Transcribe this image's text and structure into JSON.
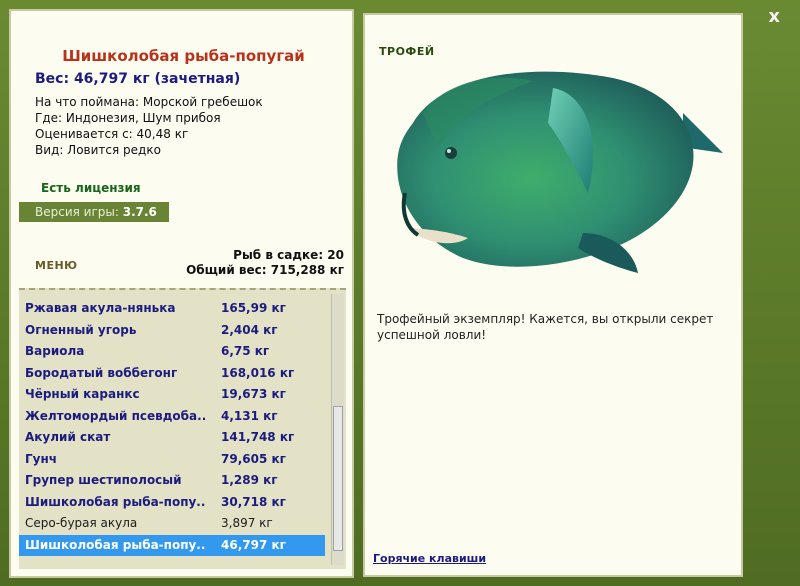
{
  "window": {
    "close_label": "x"
  },
  "fish": {
    "title": "Шишколобая рыба-попугай",
    "weight_line": "Вес: 46,797 кг (зачетная)",
    "caught_with": "На что поймана: Морской гребешок",
    "location": "Где: Индонезия, Шум прибоя",
    "min_weight": "Оценивается с: 40,48 кг",
    "rarity": "Вид: Ловится редко"
  },
  "license_text": "Есть лицензия",
  "version": {
    "label": "Версия игры:",
    "value": "3.7.6"
  },
  "menu_label": "МЕНЮ",
  "cage": {
    "count_line": "Рыб в садке: 20",
    "total_line": "Общий вес: 715,288 кг"
  },
  "catch_list": [
    {
      "name": "Ржавая акула-нянька",
      "weight": "165,99 кг",
      "style": "bold"
    },
    {
      "name": "Огненный угорь",
      "weight": "2,404 кг",
      "style": "bold"
    },
    {
      "name": "Вариола",
      "weight": "6,75 кг",
      "style": "bold"
    },
    {
      "name": "Бородатый воббегонг",
      "weight": "168,016 кг",
      "style": "bold"
    },
    {
      "name": "Чёрный каранкс",
      "weight": "19,673 кг",
      "style": "bold"
    },
    {
      "name": "Желтомордый псевдоба...",
      "weight": "4,131 кг",
      "style": "bold"
    },
    {
      "name": "Акулий скат",
      "weight": "141,748 кг",
      "style": "bold"
    },
    {
      "name": "Гунч",
      "weight": "79,605 кг",
      "style": "bold"
    },
    {
      "name": "Групер шестиполосый",
      "weight": "1,289 кг",
      "style": "bold"
    },
    {
      "name": "Шишколобая рыба-попу...",
      "weight": "30,718 кг",
      "style": "bold"
    },
    {
      "name": "Серо-бурая акула",
      "weight": "3,897 кг",
      "style": "plain"
    },
    {
      "name": "Шишколобая рыба-попу...",
      "weight": "46,797 кг",
      "style": "selected"
    }
  ],
  "trophy": {
    "label": "ТРОФЕЙ",
    "description": "Трофейный экземпляр! Кажется, вы открыли секрет успешной ловли!"
  },
  "hotkeys_label": "Горячие клавиши",
  "colors": {
    "accent_green": "#6a8435",
    "selection_blue": "#3399ee",
    "title_red": "#b8331c"
  }
}
